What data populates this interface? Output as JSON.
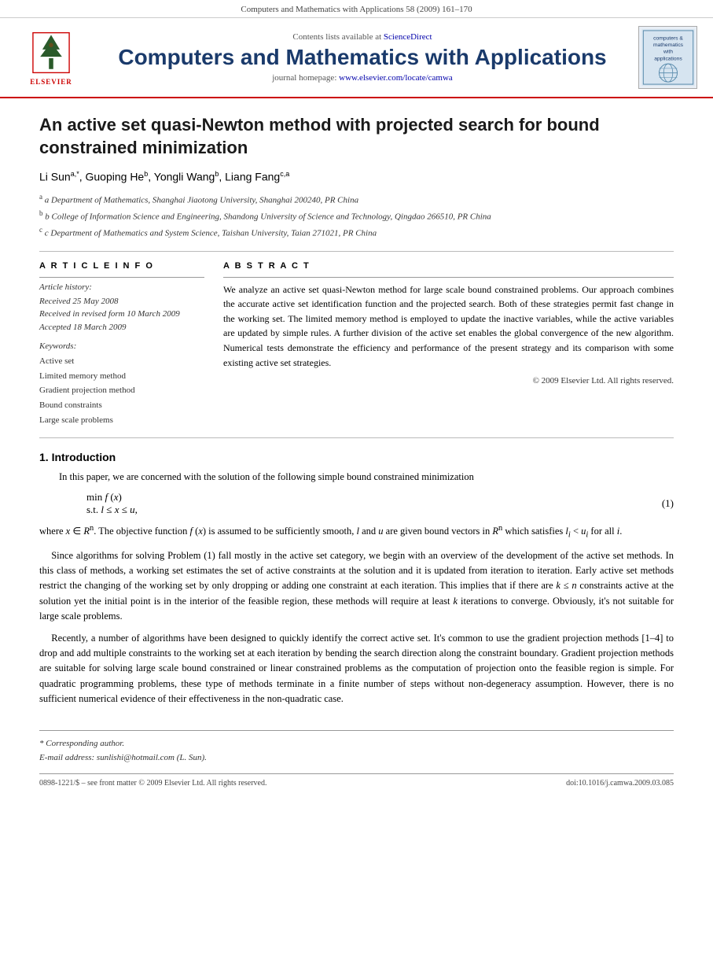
{
  "topbar": {
    "text": "Computers and Mathematics with Applications 58 (2009) 161–170"
  },
  "header": {
    "contents_available": "Contents lists available at",
    "science_direct": "ScienceDirect",
    "journal_title": "Computers and Mathematics with Applications",
    "homepage_label": "journal homepage:",
    "homepage_url": "www.elsevier.com/locate/camwa",
    "elsevier_label": "ELSEVIER",
    "cover_lines": [
      "computers &",
      "mathematics",
      "with",
      "applications"
    ]
  },
  "article": {
    "title": "An active set quasi-Newton method with projected search for bound constrained minimization",
    "authors_text": "Li Sun",
    "author_a_sup": "a,*",
    "author_b": ", Guoping He",
    "author_b_sup": "b",
    "author_c": ", Yongli Wang",
    "author_c_sup": "b",
    "author_d": ", Liang Fang",
    "author_d_sup": "c,a",
    "affil_a": "a Department of Mathematics, Shanghai Jiaotong University, Shanghai 200240, PR China",
    "affil_b": "b College of Information Science and Engineering, Shandong University of Science and Technology, Qingdao 266510, PR China",
    "affil_c": "c Department of Mathematics and System Science, Taishan University, Taian 271021, PR China"
  },
  "article_info": {
    "section_label": "A R T I C L E   I N F O",
    "history_label": "Article history:",
    "received": "Received 25 May 2008",
    "revised": "Received in revised form 10 March 2009",
    "accepted": "Accepted 18 March 2009",
    "keywords_label": "Keywords:",
    "kw1": "Active set",
    "kw2": "Limited memory method",
    "kw3": "Gradient projection method",
    "kw4": "Bound constraints",
    "kw5": "Large scale problems"
  },
  "abstract": {
    "section_label": "A B S T R A C T",
    "text": "We analyze an active set quasi-Newton method for large scale bound constrained problems. Our approach combines the accurate active set identification function and the projected search. Both of these strategies permit fast change in the working set. The limited memory method is employed to update the inactive variables, while the active variables are updated by simple rules. A further division of the active set enables the global convergence of the new algorithm. Numerical tests demonstrate the efficiency and performance of the present strategy and its comparison with some existing active set strategies.",
    "copyright": "© 2009 Elsevier Ltd. All rights reserved."
  },
  "section1": {
    "title": "1.  Introduction",
    "para1": "In this paper, we are concerned with the solution of the following simple bound constrained minimization",
    "math_line1": "min f (x)",
    "math_line2": "s.t. l ≤ x ≤ u,",
    "eq_number": "(1)",
    "para2": "where x ∈ Rⁿ. The objective function f (x) is assumed to be sufficiently smooth, l and u are given bound vectors in Rⁿ which satisfies lᵢ < uᵢ for all i.",
    "para3": "Since algorithms for solving Problem (1) fall mostly in the active set category, we begin with an overview of the development of the active set methods. In this class of methods, a working set estimates the set of active constraints at the solution and it is updated from iteration to iteration. Early active set methods restrict the changing of the working set by only dropping or adding one constraint at each iteration. This implies that if there are k ≤ n constraints active at the solution yet the initial point is in the interior of the feasible region, these methods will require at least k iterations to converge. Obviously, it's not suitable for large scale problems.",
    "para4": "Recently, a number of algorithms have been designed to quickly identify the correct active set. It's common to use the gradient projection methods [1–4] to drop and add multiple constraints to the working set at each iteration by bending the search direction along the constraint boundary. Gradient projection methods are suitable for solving large scale bound constrained or linear constrained problems as the computation of projection onto the feasible region is simple. For quadratic programming problems, these type of methods terminate in a finite number of steps without non-degeneracy assumption. However, there is no sufficient numerical evidence of their effectiveness in the non-quadratic case."
  },
  "footnotes": {
    "star": "* Corresponding author.",
    "email": "E-mail address: sunlishi@hotmail.com (L. Sun)."
  },
  "bottom": {
    "issn": "0898-1221/$ – see front matter © 2009 Elsevier Ltd. All rights reserved.",
    "doi": "doi:10.1016/j.camwa.2009.03.085"
  }
}
